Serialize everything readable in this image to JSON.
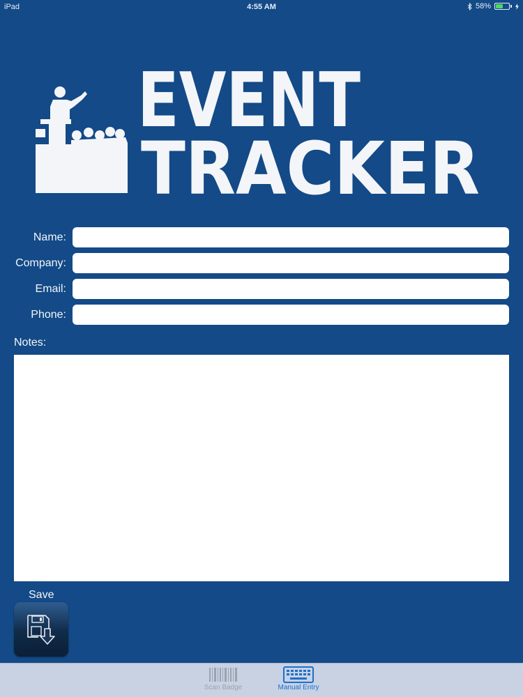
{
  "status_bar": {
    "carrier": "iPad",
    "time": "4:55 AM",
    "bluetooth_icon": "bluetooth-icon",
    "battery_percent": "58%",
    "battery_level": 0.58
  },
  "logo": {
    "line1": "EVENT",
    "line2": "TRACKER",
    "icon": "speaker-audience-icon"
  },
  "form": {
    "name": {
      "label": "Name:",
      "value": "",
      "placeholder": ""
    },
    "company": {
      "label": "Company:",
      "value": "",
      "placeholder": ""
    },
    "email": {
      "label": "Email:",
      "value": "",
      "placeholder": ""
    },
    "phone": {
      "label": "Phone:",
      "value": "",
      "placeholder": ""
    },
    "notes": {
      "label": "Notes:",
      "value": ""
    }
  },
  "save": {
    "label": "Save",
    "icon": "save-download-icon"
  },
  "tab_bar": {
    "tabs": [
      {
        "label": "Scan Badge",
        "icon": "barcode-icon",
        "selected": false
      },
      {
        "label": "Manual Entry",
        "icon": "keyboard-icon",
        "selected": true
      }
    ]
  },
  "colors": {
    "background": "#134a87",
    "tab_active": "#1e6fd0",
    "tab_inactive": "#9aa3b0",
    "battery": "#4cd964"
  }
}
